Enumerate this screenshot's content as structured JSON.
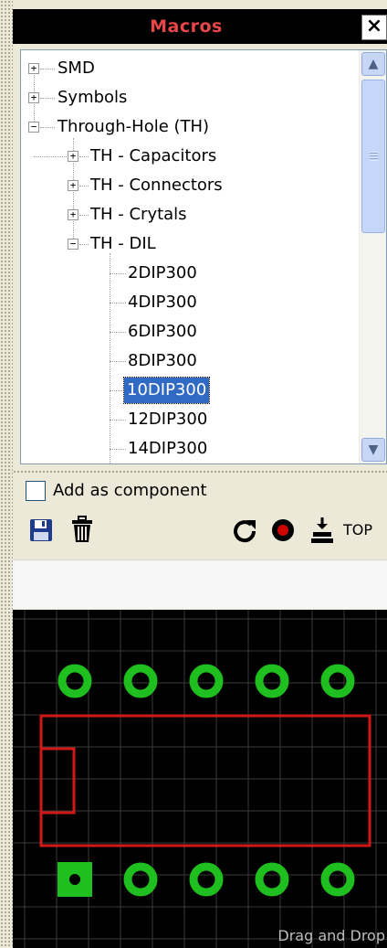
{
  "panel": {
    "title": "Macros",
    "close_label": "×"
  },
  "tree": {
    "items": [
      {
        "label": "SMD",
        "expander": "+"
      },
      {
        "label": "Symbols",
        "expander": "+"
      },
      {
        "label": "Through-Hole (TH)",
        "expander": "−"
      },
      {
        "label": "TH - Capacitors",
        "expander": "+"
      },
      {
        "label": "TH - Connectors",
        "expander": "+"
      },
      {
        "label": "TH - Crytals",
        "expander": "+"
      },
      {
        "label": "TH - DIL",
        "expander": "−"
      },
      {
        "label": "2DIP300"
      },
      {
        "label": "4DIP300"
      },
      {
        "label": "6DIP300"
      },
      {
        "label": "8DIP300"
      },
      {
        "label": "10DIP300",
        "selected": true
      },
      {
        "label": "12DIP300"
      },
      {
        "label": "14DIP300"
      }
    ],
    "scroll_up": "▲",
    "scroll_down": "▼"
  },
  "options": {
    "add_as_component": "Add as component",
    "add_as_component_checked": false
  },
  "toolbar": {
    "save_icon": "floppy-disk-icon",
    "delete_icon": "trash-icon",
    "rotate_icon": "rotate-icon",
    "record_icon": "record-icon",
    "layer_icon": "layer-top-icon",
    "layer_label": "TOP"
  },
  "preview": {
    "footer_label": "Drag and Drop",
    "colors": {
      "background": "#000000",
      "grid": "#3a3a3a",
      "pad": "#1fbf1f",
      "outline": "#d01818"
    }
  }
}
